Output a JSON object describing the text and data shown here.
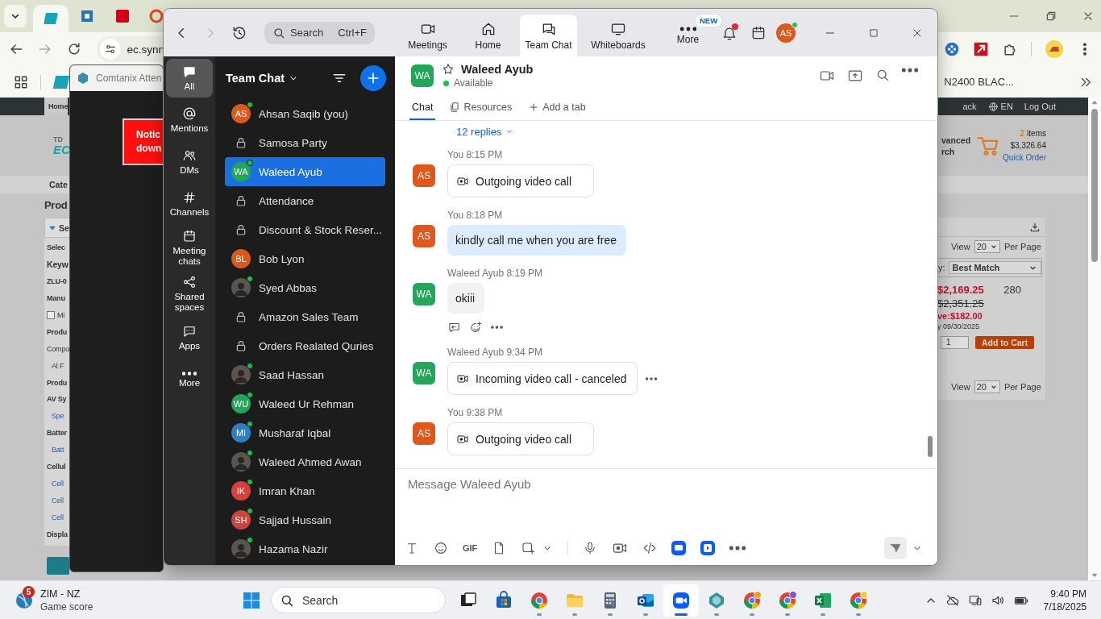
{
  "browser": {
    "address": "ec.synn",
    "bookmark": "N2400 BLAC...",
    "page": {
      "nav_left": "Home",
      "nav_right": [
        "ack",
        "EN",
        "Log Out"
      ],
      "logo_top": "TD",
      "logo": "EC",
      "search_link": [
        "vanced",
        "rch"
      ],
      "cart": {
        "count": "2",
        "label": "items",
        "total": "$3,326.64",
        "link": "Quick Order"
      },
      "band": "Cate",
      "title": "Prod",
      "filter": "Se",
      "left_panel": [
        {
          "kind": "label",
          "text": "Selec"
        },
        {
          "kind": "heading",
          "text": "Keyw"
        },
        {
          "kind": "label",
          "text": "ZLU-0"
        },
        {
          "kind": "label",
          "text": "Manu"
        },
        {
          "kind": "checkbox",
          "text": "Mi",
          "checked": false
        },
        {
          "kind": "label",
          "text": "Produ"
        },
        {
          "kind": "plain",
          "text": "Compo"
        },
        {
          "kind": "indent",
          "text": "Al F"
        },
        {
          "kind": "label",
          "text": "Produ"
        },
        {
          "kind": "label",
          "text": "AV Sy"
        },
        {
          "kind": "link",
          "text": "Spe"
        },
        {
          "kind": "label",
          "text": "Batter"
        },
        {
          "kind": "link",
          "text": "Batt"
        },
        {
          "kind": "label",
          "text": "Cellul"
        },
        {
          "kind": "link",
          "text": "Cell"
        },
        {
          "kind": "link",
          "text": "Cell"
        },
        {
          "kind": "link",
          "text": "Cell"
        },
        {
          "kind": "label",
          "text": "Displa"
        }
      ],
      "results": {
        "top_view": {
          "label": "View",
          "value": "20",
          "suffix": "Per Page"
        },
        "sort_label": "y:",
        "sort": "Best Match",
        "price": "$2,169.25",
        "stock": "280",
        "old_price": "$2,351.25",
        "save": "ve:$182.00",
        "date": "y 09/30/2025",
        "qty": "1",
        "add_button": "Add to Cart",
        "bottom_view": {
          "label": "View",
          "value": "20",
          "suffix": "Per Page"
        }
      }
    }
  },
  "attendance_window": {
    "title": "Comtanix Atten",
    "notice": [
      "Notic",
      "down"
    ]
  },
  "zoom": {
    "search": {
      "placeholder": "Search",
      "shortcut": "Ctrl+F"
    },
    "nav": [
      {
        "label": "Meetings",
        "selected": false
      },
      {
        "label": "Home",
        "selected": false
      },
      {
        "label": "Team Chat",
        "selected": true
      },
      {
        "label": "Whiteboards",
        "selected": false
      },
      {
        "label": "More",
        "selected": false,
        "badge": "NEW"
      }
    ],
    "unread_notifications": true,
    "user": {
      "initials": "AS",
      "color": "#e0571d",
      "online": true
    },
    "rail": [
      {
        "label": "All",
        "selected": true
      },
      {
        "label": "Mentions",
        "selected": false
      },
      {
        "label": "DMs",
        "selected": false
      },
      {
        "label": "Channels",
        "selected": false
      },
      {
        "label": "Meeting chats",
        "selected": false
      },
      {
        "label": "Shared spaces",
        "selected": false
      },
      {
        "label": "Apps",
        "selected": false
      },
      {
        "label": "More",
        "selected": false
      }
    ],
    "list_title": "Team Chat",
    "contacts": [
      {
        "kind": "initials",
        "initials": "AS",
        "color": "#e0571d",
        "name": "Ahsan Saqib (you)",
        "online": true,
        "selected": false
      },
      {
        "kind": "channel",
        "name": "Samosa Party",
        "selected": false
      },
      {
        "kind": "initials",
        "initials": "WA",
        "color": "#21a65a",
        "name": "Waleed Ayub",
        "online": true,
        "selected": true
      },
      {
        "kind": "channel",
        "name": "Attendance",
        "selected": false
      },
      {
        "kind": "channel",
        "name": "Discount & Stock Reser...",
        "selected": false
      },
      {
        "kind": "initials",
        "initials": "BL",
        "color": "#d9591c",
        "name": "Bob Lyon",
        "online": false,
        "selected": false
      },
      {
        "kind": "photo",
        "name": "Syed Abbas",
        "online": true,
        "selected": false
      },
      {
        "kind": "channel",
        "name": "Amazon Sales Team",
        "selected": false
      },
      {
        "kind": "channel",
        "name": "Orders Realated Quries",
        "selected": false
      },
      {
        "kind": "photo",
        "name": "Saad Hassan",
        "online": true,
        "selected": false
      },
      {
        "kind": "initials",
        "initials": "WU",
        "color": "#27a35a",
        "name": "Waleed Ur Rehman",
        "online": true,
        "selected": false
      },
      {
        "kind": "initials",
        "initials": "MI",
        "color": "#2f7fc1",
        "name": "Musharaf Iqbal",
        "online": true,
        "selected": false
      },
      {
        "kind": "photo",
        "name": "Waleed Ahmed Awan",
        "online": true,
        "selected": false
      },
      {
        "kind": "initials",
        "initials": "IK",
        "color": "#d8403b",
        "name": "Imran Khan",
        "online": true,
        "selected": false
      },
      {
        "kind": "initials",
        "initials": "SH",
        "color": "#c9463d",
        "name": "Sajjad Hussain",
        "online": true,
        "selected": false
      },
      {
        "kind": "photo",
        "name": "Hazama Nazir",
        "online": true,
        "selected": false
      }
    ],
    "conversation": {
      "initials": "WA",
      "color": "#21a65a",
      "name": "Waleed Ayub",
      "status": "Available",
      "tabs": [
        {
          "label": "Chat",
          "selected": true
        },
        {
          "label": "Resources",
          "selected": false
        },
        {
          "label": "Add a tab",
          "selected": false
        }
      ],
      "replies": "12 replies",
      "messages": [
        {
          "sender": "You",
          "time": "8:15 PM",
          "initials": "AS",
          "color": "#e0571d",
          "kind": "call",
          "text": "Outgoing video call",
          "actions": false,
          "more": false
        },
        {
          "sender": "You",
          "time": "8:18 PM",
          "initials": "AS",
          "color": "#e0571d",
          "kind": "text",
          "text": "kindly call me when you are free",
          "own": true,
          "actions": false,
          "more": false
        },
        {
          "sender": "Waleed Ayub",
          "time": "8:19 PM",
          "initials": "WA",
          "color": "#21a65a",
          "kind": "text",
          "text": "okiii",
          "own": false,
          "actions": true,
          "more": false
        },
        {
          "sender": "Waleed Ayub",
          "time": "9:34 PM",
          "initials": "WA",
          "color": "#21a65a",
          "kind": "call",
          "text": "Incoming video call - canceled",
          "actions": false,
          "more": true
        },
        {
          "sender": "You",
          "time": "9:38 PM",
          "initials": "AS",
          "color": "#e0571d",
          "kind": "call",
          "text": "Outgoing video call",
          "actions": false,
          "more": false
        }
      ],
      "composer": {
        "placeholder": "Message Waleed Ayub",
        "gif": "GIF"
      }
    }
  },
  "taskbar": {
    "widget": {
      "badge": "5",
      "title": "ZIM - NZ",
      "subtitle": "Game score"
    },
    "search": {
      "placeholder": "Search"
    },
    "apps": [
      {
        "kind": "task_view",
        "running": false,
        "selected": false
      },
      {
        "kind": "store",
        "running": false,
        "selected": false
      },
      {
        "kind": "browser",
        "running": true,
        "selected": false
      },
      {
        "kind": "folder",
        "running": true,
        "selected": false
      },
      {
        "kind": "calculator",
        "running": true,
        "selected": false
      },
      {
        "kind": "mail",
        "running": true,
        "selected": false
      },
      {
        "kind": "video_app",
        "running": true,
        "selected": true
      },
      {
        "kind": "gem",
        "running": true,
        "selected": false
      },
      {
        "kind": "browser",
        "running": true,
        "selected": false,
        "color": "#f0a020"
      },
      {
        "kind": "browser",
        "running": true,
        "selected": false,
        "color": "#8a4fd0"
      },
      {
        "kind": "spreadsheet",
        "running": true,
        "selected": false
      },
      {
        "kind": "browser",
        "running": true,
        "selected": false,
        "color": "#e8d040"
      }
    ],
    "time": "9:40 PM",
    "date": "7/18/2025"
  }
}
